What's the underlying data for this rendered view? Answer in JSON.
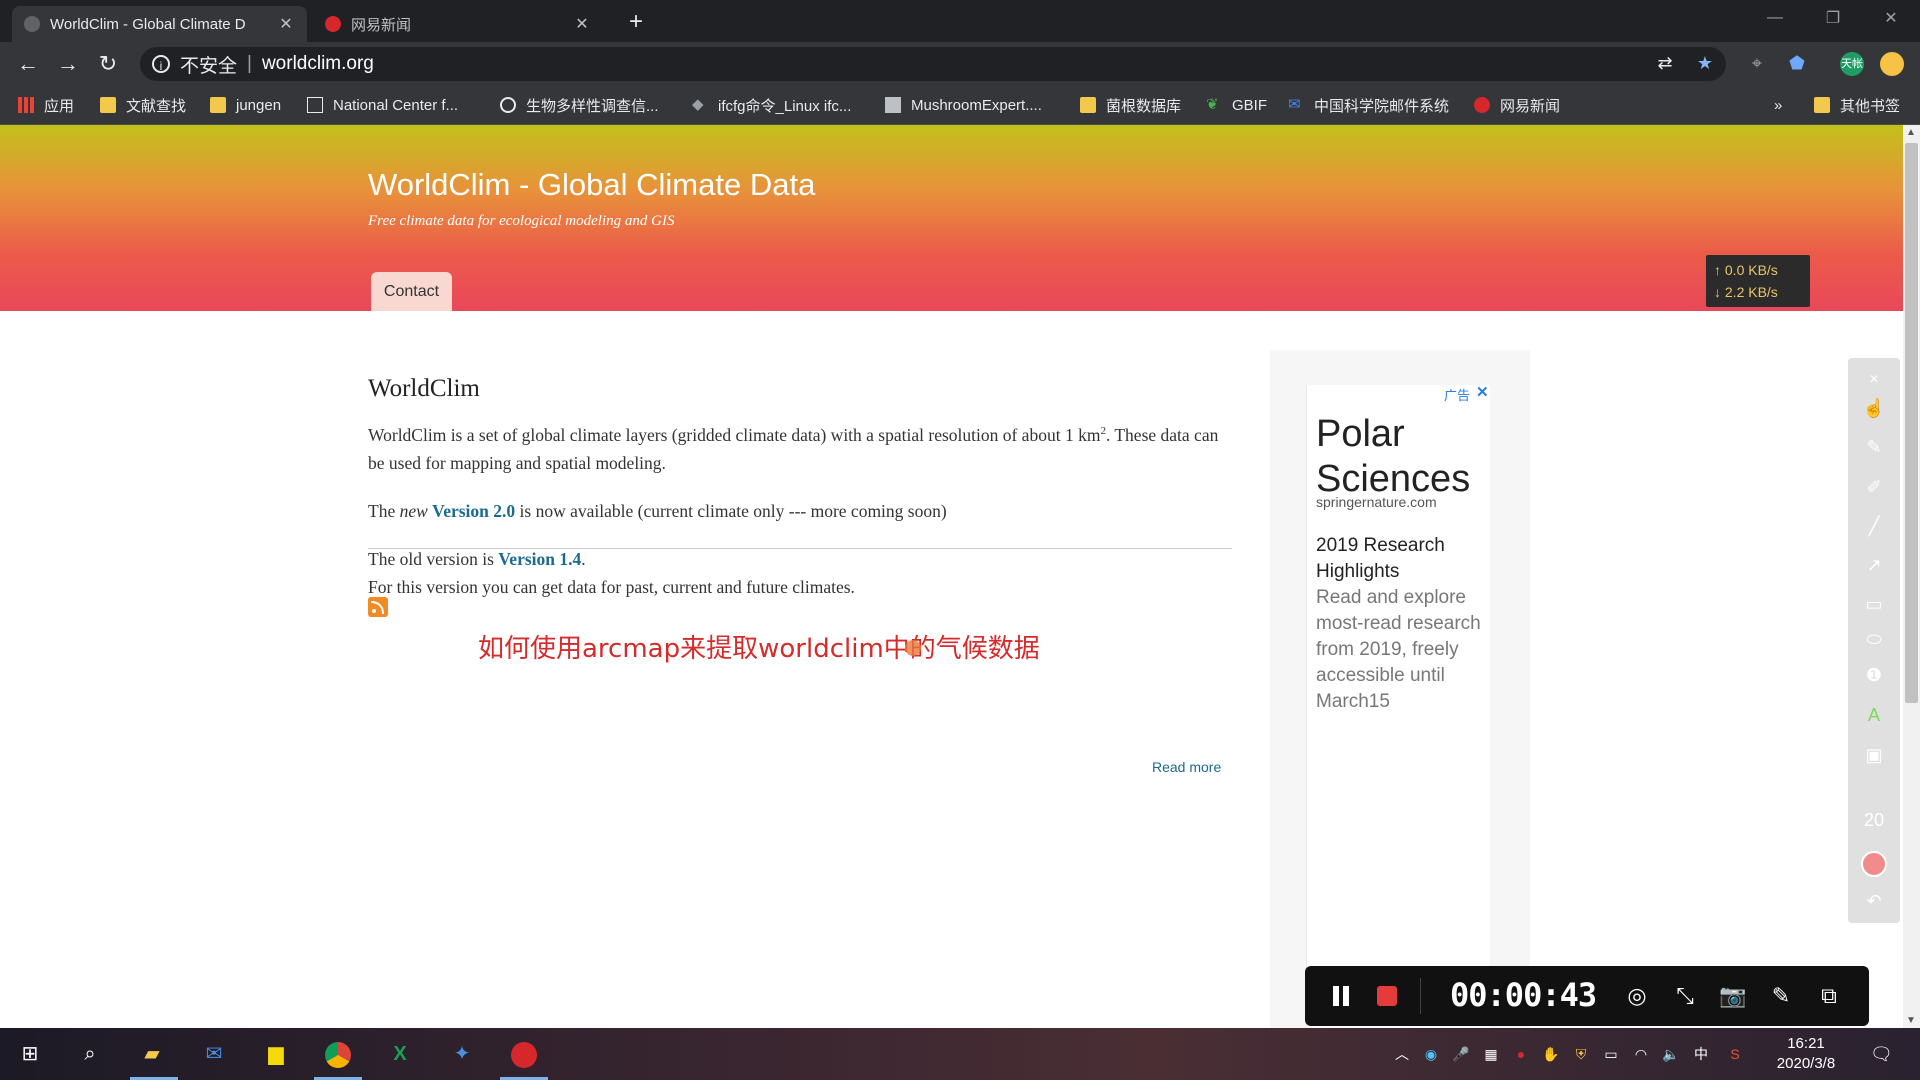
{
  "browser": {
    "tabs": [
      {
        "title": "WorldClim - Global Climate D",
        "favicon_color": "#5f6368"
      },
      {
        "title": "网易新闻",
        "favicon_color": "#d6282a"
      }
    ],
    "new_tab_symbol": "+",
    "omnibox": {
      "security_label": "不安全",
      "url": "worldclim.org"
    },
    "bookmarks": [
      {
        "label": "应用"
      },
      {
        "label": "文献查找"
      },
      {
        "label": "jungen"
      },
      {
        "label": "National Center f..."
      },
      {
        "label": "生物多样性调查信..."
      },
      {
        "label": "ifcfg命令_Linux ifc..."
      },
      {
        "label": "MushroomExpert...."
      },
      {
        "label": "菌根数据库"
      },
      {
        "label": "GBIF"
      },
      {
        "label": "中国科学院邮件系统"
      },
      {
        "label": "网易新闻"
      }
    ],
    "bookmarks_overflow": "»",
    "other_bookmarks": "其他书签",
    "extension_badge": "天帐"
  },
  "site": {
    "title": "WorldClim - Global Climate Data",
    "slogan": "Free climate data for ecological modeling and GIS",
    "nav_contact": "Contact"
  },
  "netspeed": {
    "up": "↑ 0.0 KB/s",
    "down": "↓ 2.2 KB/s"
  },
  "article": {
    "heading": "WorldClim",
    "p1_text": "WorldClim is a set of global climate layers (gridded climate data) with a spatial resolution of about 1 km",
    "p1_sup": "2",
    "p1_tail": ". These data can be used for mapping and spatial modeling.",
    "p2_the": "The ",
    "p2_new": "new",
    "p2_link": "Version 2.0",
    "p2_tail": " is now available (current climate only --- more coming soon)",
    "p3_text": "The old version is ",
    "p3_link": "Version 1.4",
    "p3_dot": ".",
    "p4_text": "For this version you can get data for past, current and future climates.",
    "read_more": "Read more"
  },
  "overlay_caption": "如何使用arcmap来提取worldclim中的气候数据",
  "ad": {
    "label": "广告",
    "close": "✕",
    "title": "Polar Sciences",
    "domain": "springernature.com",
    "headline": "2019 Research Highlights",
    "body": "Read and explore most-read research from 2019, freely accessible until March15"
  },
  "annotation_tools": {
    "size_value": "20"
  },
  "recorder": {
    "timer": "00:00:43"
  },
  "taskbar": {
    "clock_time": "16:21",
    "clock_date": "2020/3/8",
    "ime": "中"
  }
}
